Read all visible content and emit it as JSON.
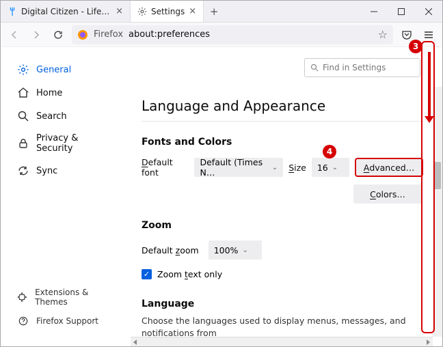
{
  "tabs": [
    {
      "label": "Digital Citizen - Life in a digital",
      "favicon_color": "#1e90ff"
    },
    {
      "label": "Settings",
      "icon": "gear"
    }
  ],
  "url": {
    "prefix": "Firefox",
    "path": "about:preferences"
  },
  "search": {
    "placeholder": "Find in Settings"
  },
  "sidebar": [
    {
      "key": "general",
      "label": "General",
      "selected": true
    },
    {
      "key": "home",
      "label": "Home"
    },
    {
      "key": "search",
      "label": "Search"
    },
    {
      "key": "privacy",
      "label": "Privacy & Security"
    },
    {
      "key": "sync",
      "label": "Sync"
    }
  ],
  "footer": [
    {
      "key": "ext",
      "label": "Extensions & Themes"
    },
    {
      "key": "support",
      "label": "Firefox Support"
    }
  ],
  "headings": {
    "section": "Language and Appearance",
    "fonts": "Fonts and Colors",
    "zoom": "Zoom",
    "language": "Language"
  },
  "fonts": {
    "default_font_label": "Default font",
    "default_font_value": "Default (Times N…",
    "size_label": "Size",
    "size_value": "16",
    "advanced": "Advanced…",
    "colors": "Colors…"
  },
  "zoom": {
    "default_label": "Default zoom",
    "default_value": "100%",
    "text_only": "Zoom text only"
  },
  "language_desc": "Choose the languages used to display menus, messages, and notifications from",
  "annotations": {
    "badge3": "3",
    "badge4": "4"
  }
}
